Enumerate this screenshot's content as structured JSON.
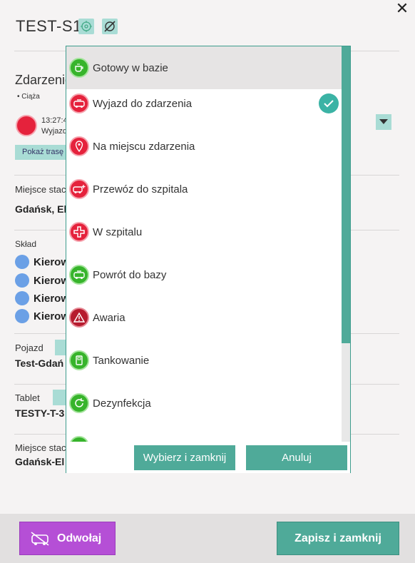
{
  "header": {
    "title": "TEST-S1",
    "close_icon": "close-icon"
  },
  "event": {
    "section_title": "Zdarzenie",
    "tag": "• Ciąża",
    "time": "13:27:4",
    "status_short": "Wyjazd",
    "route_button": "Pokaż trasę"
  },
  "place": {
    "label": "Miejsce stac",
    "value": "Gdańsk, El"
  },
  "crew": {
    "label": "Skład",
    "members": [
      "Kierow",
      "Kierow",
      "Kierow",
      "Kierow"
    ]
  },
  "vehicle": {
    "label": "Pojazd",
    "value": "Test-Gdań"
  },
  "tablet": {
    "label": "Tablet",
    "value": "TESTY-T-3"
  },
  "station": {
    "label": "Miejsce stac",
    "value": "Gdańsk-El"
  },
  "footer": {
    "cancel_label": "Odwołaj",
    "save_label": "Zapisz i zamknij"
  },
  "popup": {
    "items": [
      {
        "label": "Gotowy w bazie",
        "color": "green",
        "icon": "coffee-cup-icon"
      },
      {
        "label": "Wyjazd do zdarzenia",
        "color": "red",
        "icon": "ambulance-icon",
        "checked": true
      },
      {
        "label": "Na miejscu zdarzenia",
        "color": "red",
        "icon": "map-pin-icon"
      },
      {
        "label": "Przewóz do szpitala",
        "color": "red",
        "icon": "ambulance-plus-icon"
      },
      {
        "label": "W szpitalu",
        "color": "red",
        "icon": "medical-cross-icon"
      },
      {
        "label": "Powrót do bazy",
        "color": "green",
        "icon": "ambulance-icon"
      },
      {
        "label": "Awaria",
        "color": "darkred",
        "icon": "warning-icon"
      },
      {
        "label": "Tankowanie",
        "color": "green",
        "icon": "fuel-icon"
      },
      {
        "label": "Dezynfekcja",
        "color": "green",
        "icon": "refresh-icon"
      }
    ],
    "select_close_label": "Wybierz i zamknij",
    "cancel_label": "Anuluj"
  },
  "colors": {
    "accent": "#4faa99",
    "green": "#37b42b",
    "red": "#e5223c",
    "purple": "#b54fd6"
  }
}
